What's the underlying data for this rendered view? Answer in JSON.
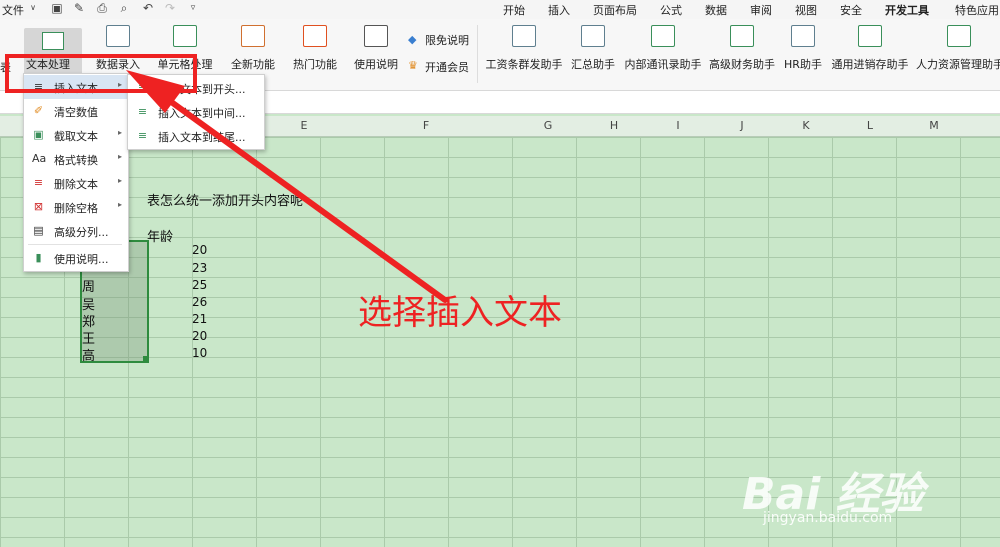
{
  "menubar": {
    "file_label": "文件",
    "tabs": [
      "开始",
      "插入",
      "页面布局",
      "公式",
      "数据",
      "审阅",
      "视图",
      "安全",
      "开发工具",
      "特色应用"
    ]
  },
  "ribbon": {
    "left_partial_label": "表",
    "text_process": "文本处理",
    "data_entry": "数据录入",
    "cell_process": "单元格处理",
    "new_features": "全新功能",
    "hot_features": "热门功能",
    "usage_guide": "使用说明",
    "free_limit": "限免说明",
    "open_member": "开通会员",
    "payroll": "工资条群发助手",
    "summary": "汇总助手",
    "internal_contacts": "内部通讯录助手",
    "finance": "高级财务助手",
    "hr": "HR助手",
    "inventory": "通用进销存助手",
    "hr_mgmt": "人力资源管理助手"
  },
  "columns": [
    "E",
    "F",
    "G",
    "H",
    "I",
    "J",
    "K",
    "L",
    "M"
  ],
  "sheet": {
    "question": "表怎么统一添加开头内容呢",
    "age_header": "年龄",
    "names": [
      "周",
      "吴",
      "郑",
      "王",
      "高"
    ],
    "ages": [
      "20",
      "23",
      "25",
      "26",
      "21",
      "20",
      "10"
    ]
  },
  "main_menu": {
    "items": [
      {
        "label": "插入文本",
        "icon": "insert-text-icon",
        "submenu": true
      },
      {
        "label": "清空数值",
        "icon": "clear-values-icon",
        "submenu": false
      },
      {
        "label": "截取文本",
        "icon": "extract-text-icon",
        "submenu": true
      },
      {
        "label": "格式转换",
        "icon": "format-convert-icon",
        "submenu": true
      },
      {
        "label": "删除文本",
        "icon": "delete-text-icon",
        "submenu": true
      },
      {
        "label": "删除空格",
        "icon": "delete-space-icon",
        "submenu": true
      },
      {
        "label": "高级分列...",
        "icon": "split-columns-icon",
        "submenu": false
      },
      {
        "label": "使用说明...",
        "icon": "help-icon",
        "submenu": false
      }
    ]
  },
  "sub_menu": {
    "items": [
      "插入文本到开头...",
      "插入文本到中间...",
      "插入文本到结尾..."
    ]
  },
  "annotation": "选择插入文本",
  "watermark": {
    "logo": "Bai 经验",
    "url": "jingyan.baidu.com"
  },
  "colors": {
    "highlight": "#ee2222",
    "sheet_bg": "#c9e7c9",
    "selection": "#2e8b3e"
  }
}
